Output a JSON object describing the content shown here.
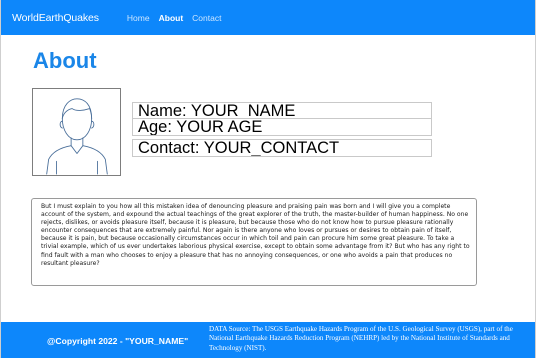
{
  "navbar": {
    "brand": "WorldEarthQuakes",
    "links": [
      {
        "label": "Home",
        "active": false
      },
      {
        "label": "About",
        "active": true
      },
      {
        "label": "Contact",
        "active": false
      }
    ],
    "color": "#0d87fb"
  },
  "page": {
    "title": "About",
    "title_color": "#1a86e8"
  },
  "profile": {
    "avatar_icon": "user-outline-icon",
    "name_line": "Name: YOUR_NAME",
    "age_line": "Age: YOUR AGE",
    "contact_line": "Contact: YOUR_CONTACT"
  },
  "about": {
    "text": "But I must explain to you how all this mistaken idea of denouncing pleasure and praising pain was born and I will give you a complete account of the system, and expound the actual teachings of the great explorer of the truth, the master-builder of human happiness. No one rejects, dislikes, or avoids pleasure itself, because it is pleasure, but because those who do not know how to pursue pleasure rationally encounter consequences that are extremely painful. Nor again is there anyone who loves or pursues or desires to obtain pain of itself, because it is pain, but because occasionally circumstances occur in which toil and pain can procure him some great pleasure. To take a trivial example, which of us ever undertakes laborious physical exercise, except to obtain some advantage from it? But who has any right to find fault with a man who chooses to enjoy a pleasure that has no annoying consequences, or one who avoids a pain that produces no resultant pleasure?"
  },
  "footer": {
    "copyright": "@Copyright 2022 - \"YOUR_NAME\"",
    "datasource": "DATA Source: The USGS Earthquake Hazards Program of the U.S. Geological Survey (USGS), part of the National Earthquake Hazards Reduction Program (NEHRP) led by the National Institute of Standards and Technology (NIST)."
  }
}
